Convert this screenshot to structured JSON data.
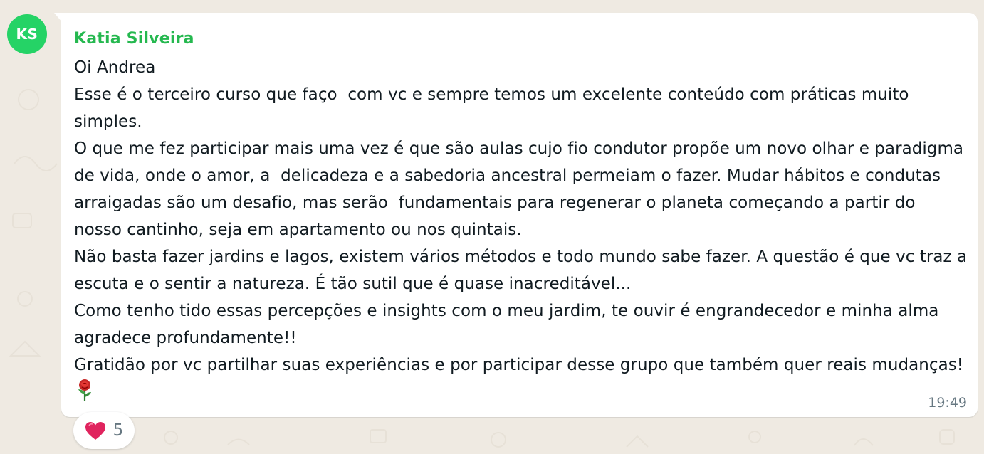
{
  "message": {
    "avatar_initials": "KS",
    "sender_name": "Katia Silveira",
    "text": "Oi Andrea\nEsse é o terceiro curso que faço  com vc e sempre temos um excelente conteúdo com práticas muito simples.\nO que me fez participar mais uma vez é que são aulas cujo fio condutor propõe um novo olhar e paradigma de vida, onde o amor, a  delicadeza e a sabedoria ancestral permeiam o fazer. Mudar hábitos e condutas arraigadas são um desafio, mas serão  fundamentais para regenerar o planeta começando a partir do nosso cantinho, seja em apartamento ou nos quintais.\nNão basta fazer jardins e lagos, existem vários métodos e todo mundo sabe fazer. A questão é que vc traz a escuta e o sentir a natureza. É tão sutil que é quase inacreditável...\nComo tenho tido essas percepções e insights com o meu jardim, te ouvir é engrandecedor e minha alma agradece profundamente!!\nGratidão por vc partilhar suas experiências e por participar desse grupo que também quer reais mudanças!",
    "trailing_emoji": "rose-emoji",
    "time": "19:49"
  },
  "reaction": {
    "emoji": "heart-icon",
    "count": "5"
  },
  "colors": {
    "background": "#efeae2",
    "avatar": "#25d366",
    "sender": "#25b84f",
    "heart": "#e0245e"
  }
}
